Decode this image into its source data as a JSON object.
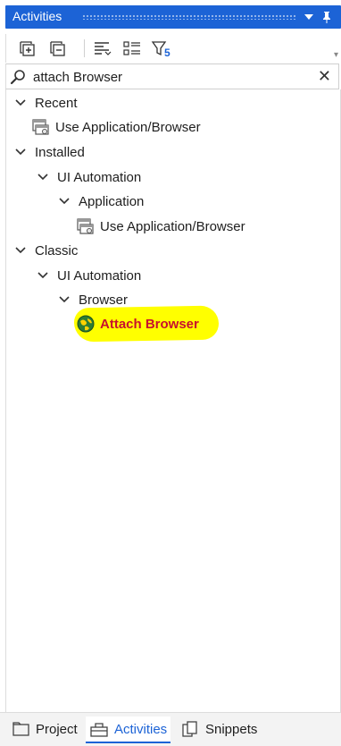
{
  "panel": {
    "title": "Activities"
  },
  "toolbar": {
    "filter_count": "5"
  },
  "search": {
    "value": "attach Browser"
  },
  "tree": {
    "recent": {
      "label": "Recent",
      "item": "Use Application/Browser"
    },
    "installed": {
      "label": "Installed",
      "ui_automation": "UI Automation",
      "application": "Application",
      "item": "Use Application/Browser"
    },
    "classic": {
      "label": "Classic",
      "ui_automation": "UI Automation",
      "browser": "Browser",
      "item": "Attach Browser"
    }
  },
  "tabs": [
    {
      "label": "Project",
      "icon": "project-icon"
    },
    {
      "label": "Activities",
      "icon": "activities-icon",
      "active": true
    },
    {
      "label": "Snippets",
      "icon": "snippets-icon"
    }
  ],
  "colors": {
    "accent": "#1c63d6",
    "highlight": "#ffff00",
    "attach_text": "#c8102e"
  }
}
